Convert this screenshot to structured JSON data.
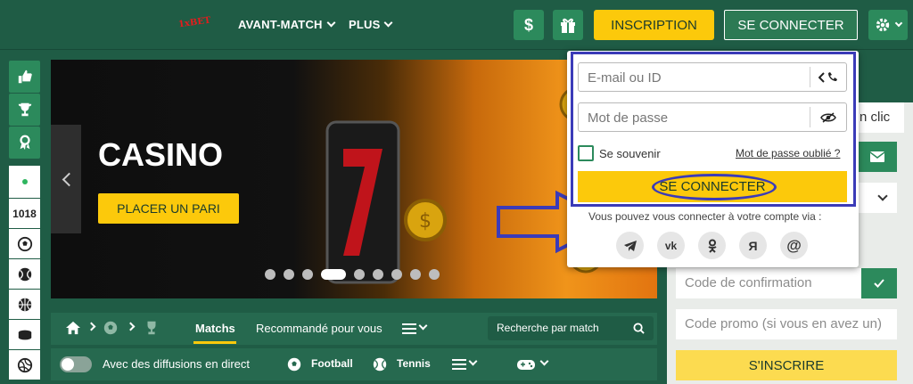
{
  "header": {
    "logo": "1xBET",
    "nav": [
      {
        "label": "AVANT-MATCH"
      },
      {
        "label": "PLUS"
      }
    ],
    "dollar": "$",
    "inscription_label": "INSCRIPTION",
    "connect_label": "SE CONNECTER"
  },
  "sidebar": {
    "count": "1018"
  },
  "banner": {
    "title": "CASINO",
    "cta": "PLACER UN PARI",
    "slides_total": 9,
    "slide_active": 4
  },
  "bottom": {
    "matchs": "Matchs",
    "recommended": "Recommandé pour vous",
    "search_placeholder": "Recherche par match",
    "live_label": "Avec des diffusions en direct",
    "football": "Football",
    "tennis": "Tennis"
  },
  "right_panel": {
    "clic": "n clic",
    "confirmation_placeholder": "Code de confirmation",
    "promo_placeholder": "Code promo (si vous en avez un)",
    "sinscrire": "S'INSCRIRE"
  },
  "login_popup": {
    "email_placeholder": "E-mail ou ID",
    "password_placeholder": "Mot de passe",
    "remember_label": "Se souvenir",
    "forgot_label": "Mot de passe oublié ?",
    "submit_label": "SE CONNECTER",
    "social_text": "Vous pouvez vous connecter à votre compte via :",
    "social_icons": [
      "telegram-icon",
      "vk-icon",
      "odnoklassniki-icon",
      "yandex-icon",
      "mail-at-icon"
    ]
  },
  "colors": {
    "brand_green": "#1f5c45",
    "accent_yellow": "#fcc90b",
    "annotation_blue": "#3b3bb8"
  }
}
